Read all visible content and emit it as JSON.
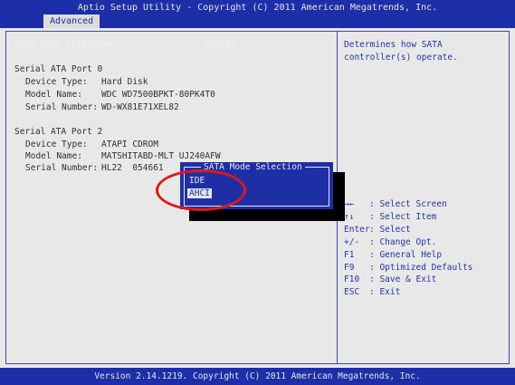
{
  "header": {
    "title": "Aptio Setup Utility - Copyright (C) 2011 American Megatrends, Inc.",
    "tab": "Advanced"
  },
  "main": {
    "sata_mode": {
      "label": "SATA Mode Selection",
      "value": "[AHCI]"
    },
    "port0": {
      "heading": "Serial ATA Port 0",
      "device_type": {
        "label": "Device Type:",
        "value": "Hard Disk"
      },
      "model": {
        "label": "Model Name:",
        "value": "WDC WD7500BPKT-80PK4T0"
      },
      "serial": {
        "label": "Serial Number:",
        "value": "WD-WX81E71XEL82"
      }
    },
    "port2": {
      "heading": "Serial ATA Port 2",
      "device_type": {
        "label": "Device Type:",
        "value": "ATAPI CDROM"
      },
      "model": {
        "label": "Model Name:",
        "value": "MATSHITABD-MLT UJ240AFW"
      },
      "serial": {
        "label": "Serial Number:",
        "value": "HL22  054661"
      }
    }
  },
  "popup": {
    "title": "SATA Mode Selection",
    "options": [
      "IDE",
      "AHCI"
    ],
    "selected": "AHCI"
  },
  "help": {
    "description": [
      "Determines how SATA",
      "controller(s) operate."
    ],
    "keys": [
      {
        "key": "→←",
        "action": ": Select Screen"
      },
      {
        "key": "↑↓",
        "action": ": Select Item"
      },
      {
        "key": "Enter",
        "action": ": Select"
      },
      {
        "key": "+/-",
        "action": ": Change Opt."
      },
      {
        "key": "F1",
        "action": ": General Help"
      },
      {
        "key": "F9",
        "action": ": Optimized Defaults"
      },
      {
        "key": "F10",
        "action": ": Save & Exit"
      },
      {
        "key": "ESC",
        "action": ": Exit"
      }
    ]
  },
  "footer": {
    "version": "Version 2.14.1219. Copyright (C) 2011 American Megatrends, Inc."
  },
  "colors": {
    "bios_blue": "#1c2fa8",
    "panel_bg": "#e8e8e8",
    "text_dark": "#303030",
    "annotation_red": "#e01818"
  }
}
